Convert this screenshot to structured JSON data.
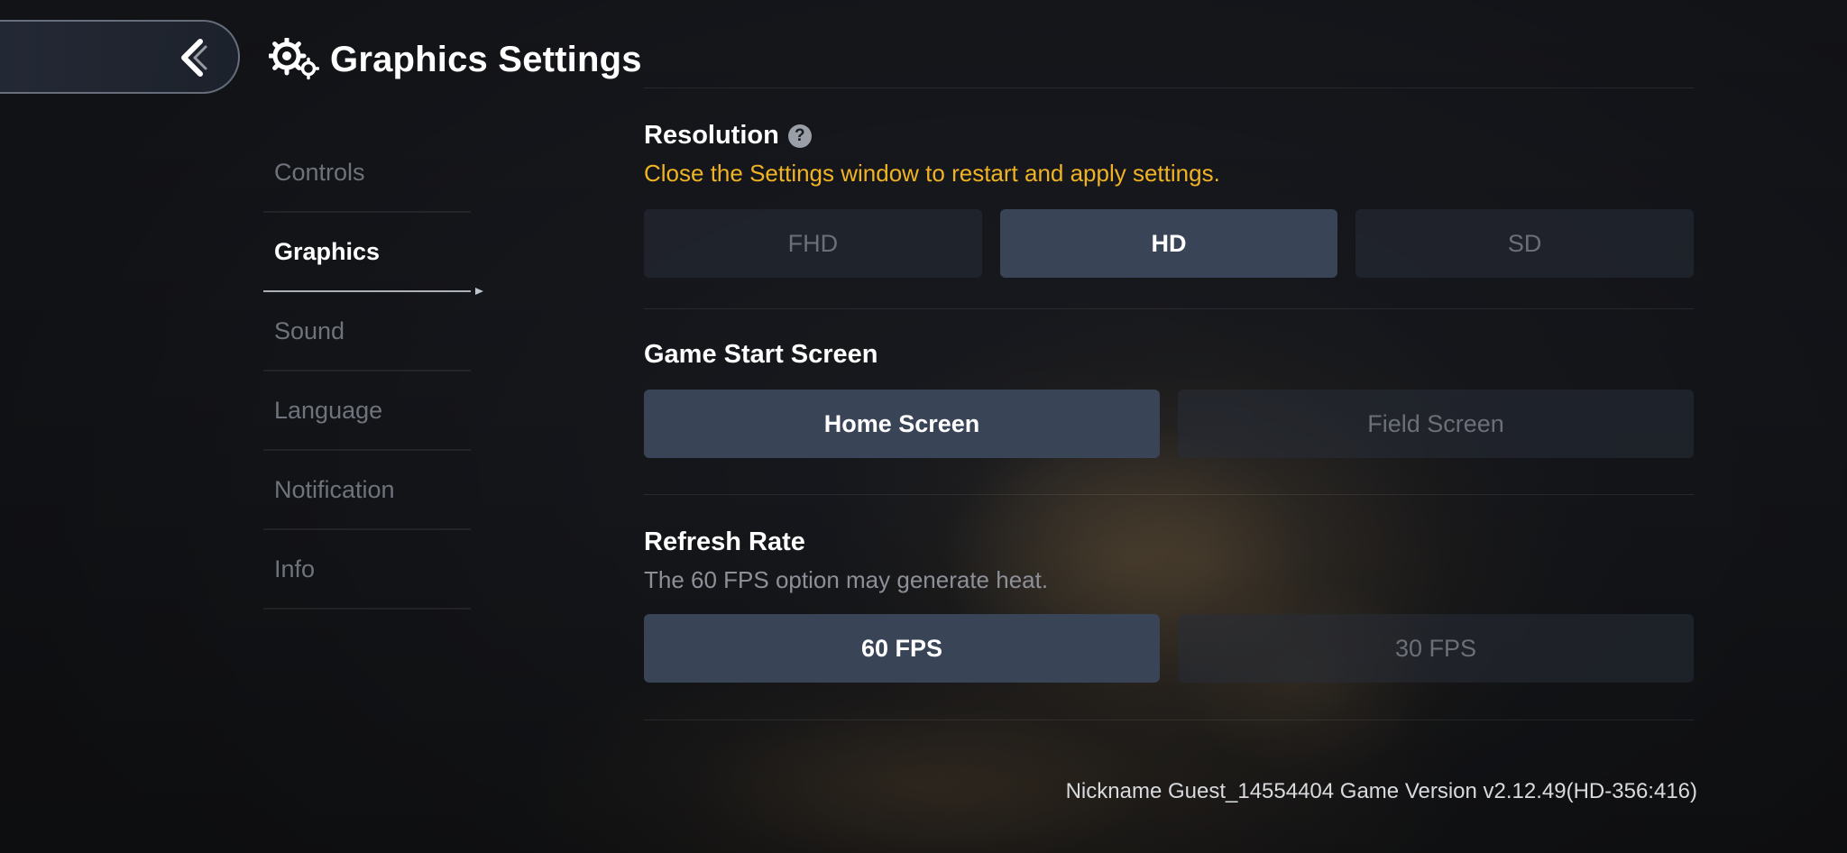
{
  "header": {
    "title": "Graphics Settings",
    "back_icon": "chevron-left-icon",
    "title_icon": "gears-icon"
  },
  "sidebar": {
    "items": [
      {
        "label": "Controls",
        "active": false
      },
      {
        "label": "Graphics",
        "active": true
      },
      {
        "label": "Sound",
        "active": false
      },
      {
        "label": "Language",
        "active": false
      },
      {
        "label": "Notification",
        "active": false
      },
      {
        "label": "Info",
        "active": false
      }
    ]
  },
  "resolution": {
    "title": "Resolution",
    "help_glyph": "?",
    "warning": "Close the Settings window to restart and apply settings.",
    "options": [
      "FHD",
      "HD",
      "SD"
    ],
    "selected": "HD"
  },
  "game_start": {
    "title": "Game Start Screen",
    "options": [
      "Home Screen",
      "Field Screen"
    ],
    "selected": "Home Screen"
  },
  "refresh_rate": {
    "title": "Refresh Rate",
    "note": "The 60 FPS option may generate heat.",
    "options": [
      "60 FPS",
      "30 FPS"
    ],
    "selected": "60 FPS"
  },
  "footer": {
    "text": "Nickname Guest_14554404 Game Version v2.12.49(HD-356:416)"
  },
  "colors": {
    "warning": "#f0b323",
    "selected_button": "#3a4457",
    "unselected_button": "#282d38"
  }
}
